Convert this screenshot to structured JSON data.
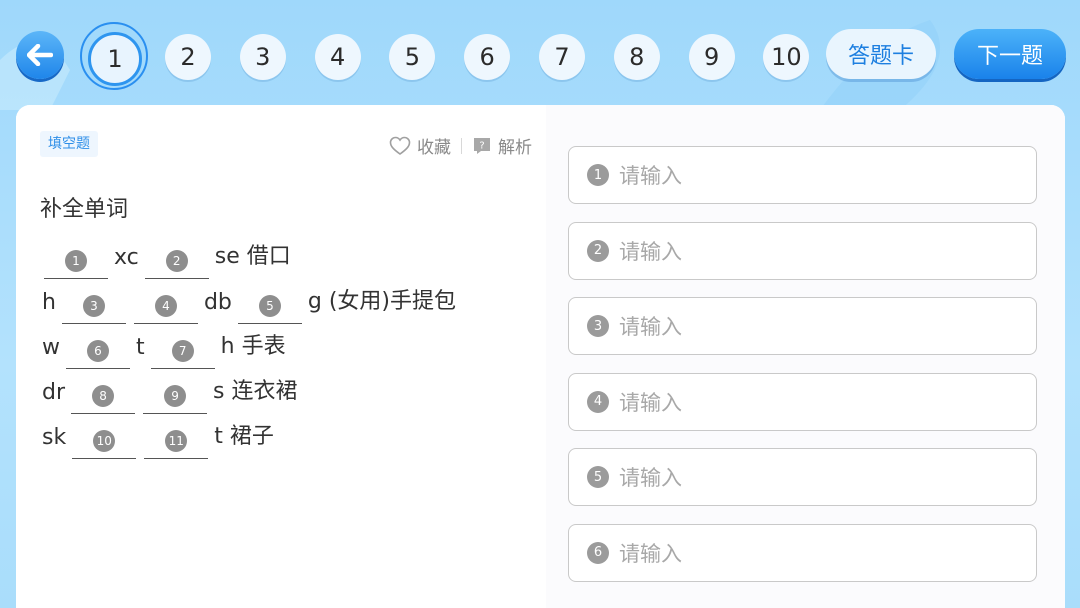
{
  "nav": {
    "back_icon": "back-arrow-icon",
    "questions": [
      "1",
      "2",
      "3",
      "4",
      "5",
      "6",
      "7",
      "8",
      "9",
      "10"
    ],
    "active_index": 0,
    "answer_card_label": "答题卡",
    "next_label": "下一题"
  },
  "question": {
    "type_label": "填空题",
    "favorite_label": "收藏",
    "analysis_label": "解析",
    "title": "补全单词",
    "lines": [
      {
        "parts": [
          {
            "blank": "1"
          },
          {
            "text": "xc"
          },
          {
            "blank": "2"
          },
          {
            "text": "se 借口"
          }
        ]
      },
      {
        "parts": [
          {
            "text": "h"
          },
          {
            "blank": "3"
          },
          {
            "blank": "4"
          },
          {
            "text": "db"
          },
          {
            "blank": "5"
          },
          {
            "text": "g (女用)手提包"
          }
        ]
      },
      {
        "parts": [
          {
            "text": "w"
          },
          {
            "blank": "6"
          },
          {
            "text": "t"
          },
          {
            "blank": "7"
          },
          {
            "text": "h 手表"
          }
        ]
      },
      {
        "parts": [
          {
            "text": "dr"
          },
          {
            "blank": "8"
          },
          {
            "blank": "9"
          },
          {
            "text": "s 连衣裙"
          }
        ]
      },
      {
        "parts": [
          {
            "text": "sk"
          },
          {
            "blank": "10"
          },
          {
            "blank": "11"
          },
          {
            "text": "t 裙子"
          }
        ]
      }
    ]
  },
  "answers": {
    "placeholder": "请输入",
    "visible_numbers": [
      "1",
      "2",
      "3",
      "4",
      "5",
      "6"
    ]
  },
  "colors": {
    "accent": "#1f86ea",
    "badge_gray": "#8e8e8e"
  }
}
